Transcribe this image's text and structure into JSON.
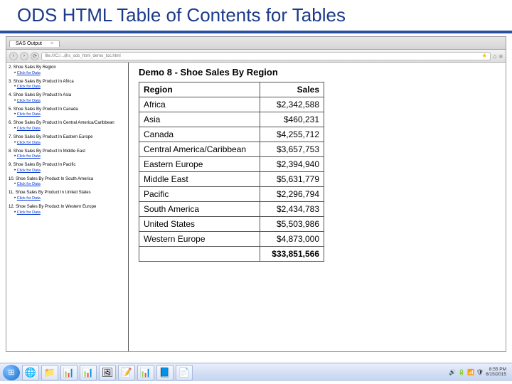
{
  "slide": {
    "title": "ODS HTML Table of Contents for Tables"
  },
  "browser": {
    "tab_label": "SAS Output",
    "url": "file:///C:/.../jhs_ods_html_demo_toc.html",
    "nav_back": "‹",
    "nav_fwd": "›",
    "reload": "⟳",
    "home": "⌂",
    "star": "★",
    "more": "≡"
  },
  "toc": [
    {
      "no": "2",
      "label": "Shoe Sales By Region",
      "link": "Click for Data"
    },
    {
      "no": "3",
      "label": "Shoe Sales By Product In Africa",
      "link": "Click for Data"
    },
    {
      "no": "4",
      "label": "Shoe Sales By Product In Asia",
      "link": "Click for Data"
    },
    {
      "no": "5",
      "label": "Shoe Sales By Product In Canada",
      "link": "Click for Data"
    },
    {
      "no": "6",
      "label": "Shoe Sales By Product In Central America/Caribbean",
      "link": "Click for Data"
    },
    {
      "no": "7",
      "label": "Shoe Sales By Product In Eastern Europe",
      "link": "Click for Data"
    },
    {
      "no": "8",
      "label": "Shoe Sales By Product In Middle East",
      "link": "Click for Data"
    },
    {
      "no": "9",
      "label": "Shoe Sales By Product In Pacific",
      "link": "Click for Data"
    },
    {
      "no": "10",
      "label": "Shoe Sales By Product In South America",
      "link": "Click for Data"
    },
    {
      "no": "11",
      "label": "Shoe Sales By Product In United States",
      "link": "Click for Data"
    },
    {
      "no": "12",
      "label": "Shoe Sales By Product In Western Europe",
      "link": "Click for Data"
    }
  ],
  "report": {
    "title": "Demo 8 - Shoe Sales By Region",
    "columns": {
      "region": "Region",
      "sales": "Sales"
    },
    "rows": [
      [
        "Africa",
        "$2,342,588"
      ],
      [
        "Asia",
        "$460,231"
      ],
      [
        "Canada",
        "$4,255,712"
      ],
      [
        "Central America/Caribbean",
        "$3,657,753"
      ],
      [
        "Eastern Europe",
        "$2,394,940"
      ],
      [
        "Middle East",
        "$5,631,779"
      ],
      [
        "Pacific",
        "$2,296,794"
      ],
      [
        "South America",
        "$2,434,783"
      ],
      [
        "United States",
        "$5,503,986"
      ],
      [
        "Western Europe",
        "$4,873,000"
      ]
    ],
    "total": [
      "",
      "$33,851,566"
    ]
  },
  "taskbar": {
    "start": "⊞",
    "items": [
      "🌐",
      "📁",
      "📊",
      "📊",
      "🖼",
      "📝",
      "📊",
      "📘",
      "📄"
    ],
    "tray_icons": [
      "🔊",
      "🔋",
      "📶",
      "🛡"
    ],
    "time": "8:55 PM",
    "date": "6/15/2015"
  },
  "chart_data": {
    "type": "table",
    "title": "Demo 8 - Shoe Sales By Region",
    "columns": [
      "Region",
      "Sales"
    ],
    "rows": [
      [
        "Africa",
        2342588
      ],
      [
        "Asia",
        460231
      ],
      [
        "Canada",
        4255712
      ],
      [
        "Central America/Caribbean",
        3657753
      ],
      [
        "Eastern Europe",
        2394940
      ],
      [
        "Middle East",
        5631779
      ],
      [
        "Pacific",
        2296794
      ],
      [
        "South America",
        2434783
      ],
      [
        "United States",
        5503986
      ],
      [
        "Western Europe",
        4873000
      ]
    ],
    "total": 33851566
  }
}
